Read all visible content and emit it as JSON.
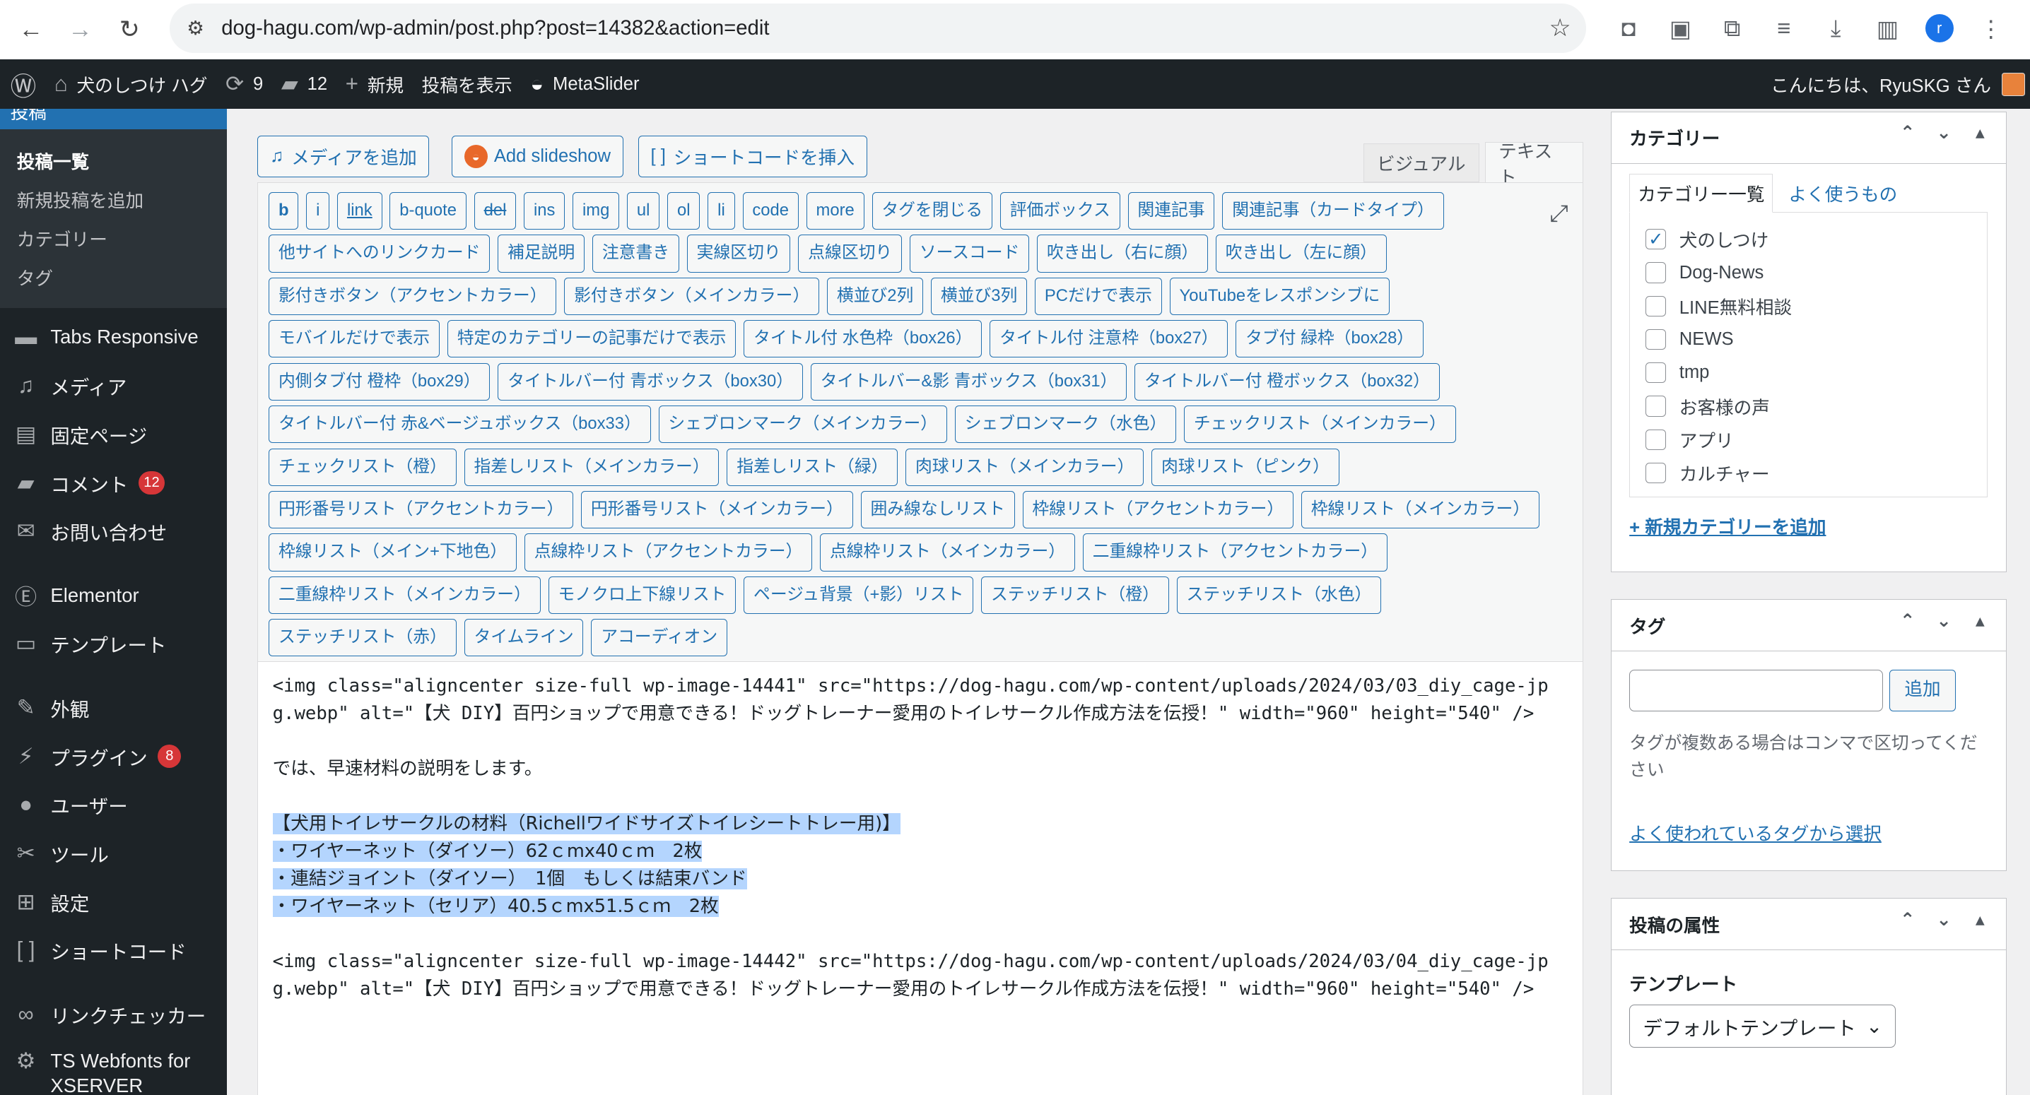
{
  "browser": {
    "url": "dog-hagu.com/wp-admin/post.php?post=14382&action=edit",
    "profile_initial": "r"
  },
  "adminbar": {
    "site_name": "犬のしつけ ハグ",
    "updates": "9",
    "comments": "12",
    "new": "新規",
    "view_post": "投稿を表示",
    "metaslider": "MetaSlider",
    "greeting": "こんにちは、RyuSKG さん"
  },
  "sidebar": {
    "posts_label": "投稿",
    "submenu": [
      "投稿一覧",
      "新規投稿を追加",
      "カテゴリー",
      "タグ"
    ],
    "items": [
      {
        "label": "Tabs Responsive",
        "icon": "folder-icon"
      },
      {
        "label": "メディア",
        "icon": "media-icon"
      },
      {
        "label": "固定ページ",
        "icon": "page-icon"
      },
      {
        "label": "コメント",
        "icon": "comment-icon",
        "badge": "12"
      },
      {
        "label": "お問い合わせ",
        "icon": "mail-icon"
      },
      {
        "label": "Elementor",
        "icon": "elementor-icon"
      },
      {
        "label": "テンプレート",
        "icon": "folder-open-icon"
      },
      {
        "label": "外観",
        "icon": "brush-icon"
      },
      {
        "label": "プラグイン",
        "icon": "plugin-icon",
        "badge": "8"
      },
      {
        "label": "ユーザー",
        "icon": "user-icon"
      },
      {
        "label": "ツール",
        "icon": "wrench-icon"
      },
      {
        "label": "設定",
        "icon": "settings-icon"
      },
      {
        "label": "ショートコード",
        "icon": "brackets-icon"
      },
      {
        "label": "リンクチェッカー",
        "icon": "link-checker-icon"
      },
      {
        "label": "TS Webfonts for XSERVER",
        "icon": "gear-icon"
      }
    ]
  },
  "editor": {
    "add_media": "メディアを追加",
    "add_slideshow": "Add slideshow",
    "insert_shortcode": "ショートコードを挿入",
    "tab_visual": "ビジュアル",
    "tab_text": "テキスト",
    "quicktags": [
      "b",
      "i",
      "link",
      "b-quote",
      "del",
      "ins",
      "img",
      "ul",
      "ol",
      "li",
      "code",
      "more",
      "タグを閉じる",
      "評価ボックス",
      "関連記事",
      "関連記事（カードタイプ）",
      "他サイトへのリンクカード",
      "補足説明",
      "注意書き",
      "実線区切り",
      "点線区切り",
      "ソースコード",
      "吹き出し（右に顔）",
      "吹き出し（左に顔）",
      "影付きボタン（アクセントカラー）",
      "影付きボタン（メインカラー）",
      "横並び2列",
      "横並び3列",
      "PCだけで表示",
      "YouTubeをレスポンシブに",
      "モバイルだけで表示",
      "特定のカテゴリーの記事だけで表示",
      "タイトル付 水色枠（box26）",
      "タイトル付 注意枠（box27）",
      "タブ付 緑枠（box28）",
      "内側タブ付 橙枠（box29）",
      "タイトルバー付 青ボックス（box30）",
      "タイトルバー&影 青ボックス（box31）",
      "タイトルバー付 橙ボックス（box32）",
      "タイトルバー付 赤&ベージュボックス（box33）",
      "シェブロンマーク（メインカラー）",
      "シェブロンマーク（水色）",
      "チェックリスト（メインカラー）",
      "チェックリスト（橙）",
      "指差しリスト（メインカラー）",
      "指差しリスト（緑）",
      "肉球リスト（メインカラー）",
      "肉球リスト（ピンク）",
      "円形番号リスト（アクセントカラー）",
      "円形番号リスト（メインカラー）",
      "囲み線なしリスト",
      "枠線リスト（アクセントカラー）",
      "枠線リスト（メインカラー）",
      "枠線リスト（メイン+下地色）",
      "点線枠リスト（アクセントカラー）",
      "点線枠リスト（メインカラー）",
      "二重線枠リスト（アクセントカラー）",
      "二重線枠リスト（メインカラー）",
      "モノクロ上下線リスト",
      "ページュ背景（+影）リスト",
      "ステッチリスト（橙）",
      "ステッチリスト（水色）",
      "ステッチリスト（赤）",
      "タイムライン",
      "アコーディオン"
    ],
    "content": {
      "img1": "<img class=\"aligncenter size-full wp-image-14441\" src=\"https://dog-hagu.com/wp-content/uploads/2024/03/03_diy_cage-jpg.webp\" alt=\"【犬 DIY】百円ショップで用意できる！ドッグトレーナー愛用のトイレサークル作成方法を伝授！\" width=\"960\" height=\"540\" />",
      "intro": "では、早速材料の説明をします。",
      "materials": [
        "【犬用トイレサークルの材料（Richellワイドサイズトイレシートトレー用)】",
        "・ワイヤーネット（ダイソー）62ｃmx40ｃｍ　2枚",
        "・連結ジョイント（ダイソー）　1個　もしくは結束バンド",
        "・ワイヤーネット（セリア）40.5ｃmx51.5ｃｍ　2枚"
      ],
      "img2": "<img class=\"aligncenter size-full wp-image-14442\" src=\"https://dog-hagu.com/wp-content/uploads/2024/03/04_diy_cage-jpg.webp\" alt=\"【犬 DIY】百円ショップで用意できる！ドッグトレーナー愛用のトイレサークル作成方法を伝授！\" width=\"960\" height=\"540\" />"
    }
  },
  "categories": {
    "title": "カテゴリー",
    "tab_all": "カテゴリー一覧",
    "tab_popular": "よく使うもの",
    "items": [
      {
        "label": "犬のしつけ",
        "checked": true
      },
      {
        "label": "Dog-News",
        "checked": false
      },
      {
        "label": "LINE無料相談",
        "checked": false
      },
      {
        "label": "NEWS",
        "checked": false
      },
      {
        "label": "tmp",
        "checked": false
      },
      {
        "label": "お客様の声",
        "checked": false
      },
      {
        "label": "アプリ",
        "checked": false
      },
      {
        "label": "カルチャー",
        "checked": false
      }
    ],
    "add_new": "+ 新規カテゴリーを追加"
  },
  "tags": {
    "title": "タグ",
    "add_button": "追加",
    "hint": "タグが複数ある場合はコンマで区切ってください",
    "popular_link": "よく使われているタグから選択"
  },
  "attributes": {
    "title": "投稿の属性",
    "template_label": "テンプレート",
    "template_value": "デフォルトテンプレート"
  },
  "colors": {
    "admin_bg": "#1d2327",
    "accent": "#2271b1",
    "badge": "#d63638"
  }
}
